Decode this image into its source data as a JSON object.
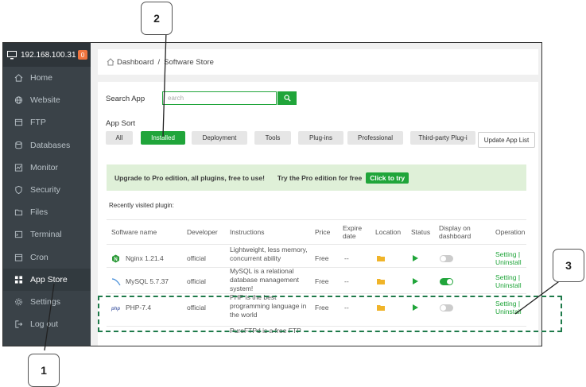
{
  "sidebar": {
    "ip": "192.168.100.31",
    "badge": "0",
    "items": [
      {
        "label": "Home",
        "icon": "home-icon"
      },
      {
        "label": "Website",
        "icon": "globe-icon"
      },
      {
        "label": "FTP",
        "icon": "ftp-icon"
      },
      {
        "label": "Databases",
        "icon": "database-icon"
      },
      {
        "label": "Monitor",
        "icon": "monitor-icon"
      },
      {
        "label": "Security",
        "icon": "shield-icon"
      },
      {
        "label": "Files",
        "icon": "folder-icon"
      },
      {
        "label": "Terminal",
        "icon": "terminal-icon"
      },
      {
        "label": "Cron",
        "icon": "clock-icon"
      },
      {
        "label": "App Store",
        "icon": "grid-icon"
      },
      {
        "label": "Settings",
        "icon": "gear-icon"
      },
      {
        "label": "Log out",
        "icon": "logout-icon"
      }
    ]
  },
  "breadcrumb": {
    "home": "Dashboard",
    "current": "Software Store"
  },
  "search": {
    "label": "Search App",
    "placeholder": "earch"
  },
  "sort": {
    "label": "App Sort",
    "buttons": [
      "All",
      "Installed",
      "Deployment",
      "Tools",
      "Plug-ins",
      "Professional",
      "Third-party Plug-i"
    ],
    "update_label": "Update App List"
  },
  "promo": {
    "text": "Upgrade to Pro edition, all plugins, free to use!",
    "try_text": "Try the Pro edition for free",
    "button": "Click to try"
  },
  "recent_label": "Recently visited plugin:",
  "table": {
    "headers": [
      "Software name",
      "Developer",
      "Instructions",
      "Price",
      "Expire date",
      "Location",
      "Status",
      "Display on dashboard",
      "Operation"
    ],
    "rows": [
      {
        "name": "Nginx 1.21.4",
        "developer": "official",
        "instr": [
          "Lightweight, less memory,",
          "concurrent ability"
        ],
        "price": "Free",
        "expire": "--",
        "display_on": false
      },
      {
        "name": "MySQL 5.7.37",
        "developer": "official",
        "instr": [
          "MySQL is a relational",
          "database management",
          "system!"
        ],
        "price": "Free",
        "expire": "--",
        "display_on": true
      },
      {
        "name": "PHP-7.4",
        "developer": "official",
        "instr": [
          "PHP is the best",
          "programming language in",
          "the world"
        ],
        "price": "Free",
        "expire": "--",
        "display_on": false
      },
      {
        "name": "",
        "developer": "",
        "instr": [
          "PureFTPd is a free FTP"
        ],
        "price": "",
        "expire": "",
        "display_on": null
      }
    ],
    "op_setting": "Setting |",
    "op_uninstall": "Uninstall"
  },
  "callouts": [
    "1",
    "2",
    "3"
  ],
  "colors": {
    "accent": "#20a53a",
    "sidebar": "#3a4248",
    "badge": "#f0743e"
  }
}
